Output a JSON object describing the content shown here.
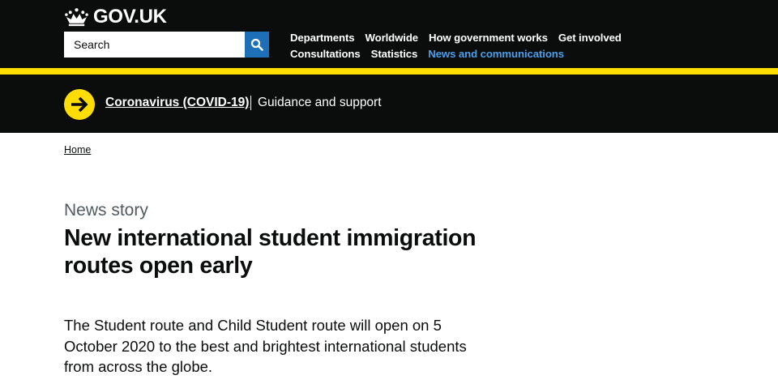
{
  "header": {
    "logo_text": "GOV.UK",
    "search_placeholder": "Search",
    "nav": {
      "row1": [
        "Departments",
        "Worldwide",
        "How government works",
        "Get involved"
      ],
      "row2": [
        "Consultations",
        "Statistics",
        "News and communications"
      ]
    }
  },
  "covid_banner": {
    "link": "Coronavirus (COVID-19)",
    "guidance": "Guidance and support"
  },
  "breadcrumb": {
    "home": "Home"
  },
  "article": {
    "caption": "News story",
    "title": "New international student immigration routes open early",
    "lead": "The Student route and Child Student route will open on 5 October 2020 to the best and brightest international students from across the globe."
  },
  "colors": {
    "header_bg": "#0b0c0c",
    "accent_yellow": "#ffdd00",
    "search_button": "#1d70b8",
    "active_link": "#4c9ee8"
  },
  "icons": [
    "crown-icon",
    "search-icon",
    "arrow-right-icon"
  ]
}
